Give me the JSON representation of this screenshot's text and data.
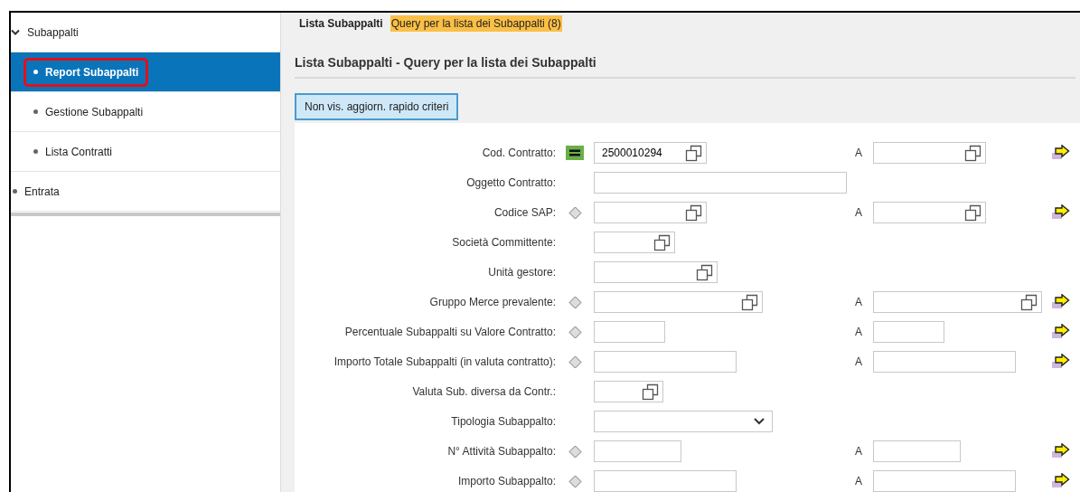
{
  "sidebar": {
    "items": [
      {
        "label": "Subappalti",
        "kind": "group",
        "expanded": true,
        "selected": false,
        "children": [
          {
            "label": "Report Subappalti",
            "selected": true,
            "highlighted": true
          },
          {
            "label": "Gestione Subappalti",
            "selected": false,
            "highlighted": false
          },
          {
            "label": "Lista Contratti",
            "selected": false,
            "highlighted": false
          }
        ]
      },
      {
        "label": "Entrata",
        "kind": "leaf",
        "selected": false
      }
    ]
  },
  "breadcrumb": {
    "title": "Lista Subappalti",
    "current": "Query per la lista dei Subappalti (8)"
  },
  "heading": "Lista Subappalti - Query per la lista dei Subappalti",
  "toggle_button": "Non vis. aggiorn. rapido criteri",
  "fields": [
    {
      "label": "Cod. Contratto:",
      "operator": {
        "kind": "equals"
      },
      "input": {
        "kind": "help",
        "value": "2500010294"
      },
      "range": {
        "label": "A",
        "input": {
          "kind": "help"
        }
      }
    },
    {
      "label": "Oggetto Contratto:",
      "input": {
        "kind": "text"
      }
    },
    {
      "label": "Codice SAP:",
      "operator": {
        "kind": "diamond"
      },
      "input": {
        "kind": "help"
      },
      "range": {
        "label": "A",
        "input": {
          "kind": "help"
        }
      }
    },
    {
      "label": "Società Committente:",
      "input": {
        "kind": "help"
      }
    },
    {
      "label": "Unità gestore:",
      "input": {
        "kind": "help"
      }
    },
    {
      "label": "Gruppo Merce prevalente:",
      "operator": {
        "kind": "diamond"
      },
      "input": {
        "kind": "help"
      },
      "range": {
        "label": "A",
        "input": {
          "kind": "help"
        }
      }
    },
    {
      "label": "Percentuale Subappalti su Valore Contratto:",
      "operator": {
        "kind": "diamond"
      },
      "input": {
        "kind": "text"
      },
      "range": {
        "label": "A",
        "input": {
          "kind": "text"
        }
      }
    },
    {
      "label": "Importo Totale Subappalti (in valuta contratto):",
      "operator": {
        "kind": "diamond"
      },
      "input": {
        "kind": "text"
      },
      "range": {
        "label": "A",
        "input": {
          "kind": "text"
        }
      }
    },
    {
      "label": "Valuta Sub. diversa da Contr.:",
      "input": {
        "kind": "help"
      }
    },
    {
      "label": "Tipologia Subappalto:",
      "input": {
        "kind": "select"
      }
    },
    {
      "label": "N° Attività Subappalto:",
      "operator": {
        "kind": "diamond"
      },
      "input": {
        "kind": "text"
      },
      "range": {
        "label": "A",
        "input": {
          "kind": "text"
        }
      }
    },
    {
      "label": "Importo Subappalto:",
      "operator": {
        "kind": "diamond"
      },
      "input": {
        "kind": "text"
      },
      "range": {
        "label": "A",
        "input": {
          "kind": "text"
        }
      }
    }
  ]
}
